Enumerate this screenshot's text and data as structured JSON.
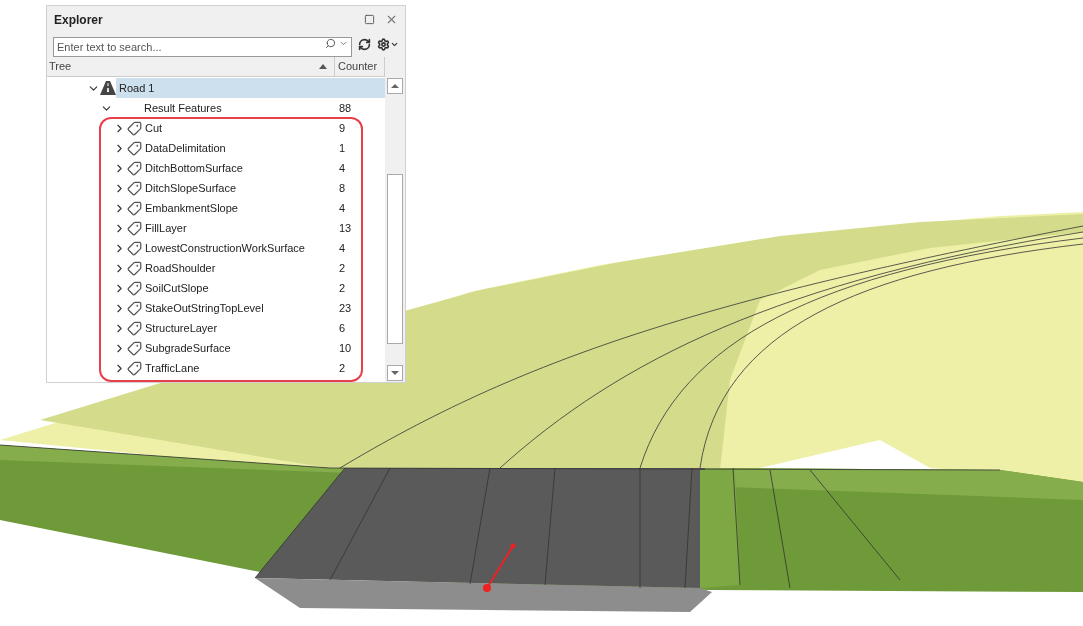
{
  "explorer": {
    "title": "Explorer",
    "search": {
      "placeholder": "Enter text to search..."
    },
    "columns": [
      "Tree",
      "Counter"
    ],
    "tree": [
      {
        "label": "Road 1",
        "kind": "road",
        "selected": true,
        "expanded": true,
        "children": [
          {
            "label": "Result Features",
            "counter": "88",
            "selected": false,
            "expanded": true,
            "children": [
              {
                "label": "Cut",
                "kind": "feature",
                "counter": "9",
                "selected": false,
                "expanded": false
              },
              {
                "label": "DataDelimitation",
                "kind": "feature",
                "counter": "1",
                "selected": false,
                "expanded": false
              },
              {
                "label": "DitchBottomSurface",
                "kind": "feature",
                "counter": "4",
                "selected": false,
                "expanded": false
              },
              {
                "label": "DitchSlopeSurface",
                "kind": "feature",
                "counter": "8",
                "selected": false,
                "expanded": false
              },
              {
                "label": "EmbankmentSlope",
                "kind": "feature",
                "counter": "4",
                "selected": false,
                "expanded": false
              },
              {
                "label": "FillLayer",
                "kind": "feature",
                "counter": "13",
                "selected": false,
                "expanded": false
              },
              {
                "label": "LowestConstructionWorkSurface",
                "kind": "feature",
                "counter": "4",
                "selected": false,
                "expanded": false
              },
              {
                "label": "RoadShoulder",
                "kind": "feature",
                "counter": "2",
                "selected": false,
                "expanded": false
              },
              {
                "label": "SoilCutSlope",
                "kind": "feature",
                "counter": "2",
                "selected": false,
                "expanded": false
              },
              {
                "label": "StakeOutStringTopLevel",
                "kind": "feature",
                "counter": "23",
                "selected": false,
                "expanded": false
              },
              {
                "label": "StructureLayer",
                "kind": "feature",
                "counter": "6",
                "selected": false,
                "expanded": false
              },
              {
                "label": "SubgradeSurface",
                "kind": "feature",
                "counter": "10",
                "selected": false,
                "expanded": false
              },
              {
                "label": "TrafficLane",
                "kind": "feature",
                "counter": "2",
                "selected": false,
                "expanded": false
              }
            ]
          }
        ]
      }
    ]
  }
}
